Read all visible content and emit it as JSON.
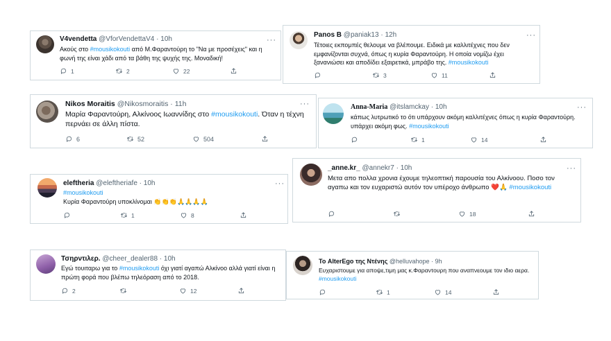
{
  "tweets": [
    {
      "name": "V4vendetta",
      "handle": "@VforVendettaV4",
      "time": "10h",
      "text_before": "Ακούς στο ",
      "hashtag": "#mousikokouti",
      "text_after": " από Μ.Φαραντούρη το \"Να με προσέχεις\" και η φωνή της είναι χάδι από τα βάθη της ψυχής της. Μοναδική!",
      "replies": "1",
      "retweets": "2",
      "likes": "22"
    },
    {
      "name": "Panos B",
      "handle": "@paniak13",
      "time": "12h",
      "text_before": "Τέτοιες εκπομπές θελουμε να βλέπουμε. Ειδικά με καλλιτέχνες που δεν εμφανίζονται συχνά, όπως η κυρία Φαραντούρη. Η οποία νομίζω έχει ξανανιώσει και αποδίδει εξαιρετικά, μπράβο της. ",
      "hashtag": "#mousikokouti",
      "text_after": "",
      "replies": "",
      "retweets": "3",
      "likes": "11"
    },
    {
      "name": "Nikos Moraitis",
      "handle": "@Nikosmoraitis",
      "time": "11h",
      "text_before": "Μαρία Φαραντούρη, Αλκίνοος Ιωαννίδης στο ",
      "hashtag": "#mousikokouti",
      "text_after": ". Όταν η τέχνη περνάει σε άλλη πίστα.",
      "replies": "6",
      "retweets": "52",
      "likes": "504"
    },
    {
      "name": "Anna-Maria",
      "handle": "@itslamckay",
      "time": "10h",
      "text_before": "κάπως λυτρωτικό το ότι υπάρχουν ακόμη καλλιτέχνες όπως η κυρία Φαραντούρη. υπάρχει ακόμη φως. ",
      "hashtag": "#mousikokouti",
      "text_after": "",
      "replies": "",
      "retweets": "1",
      "likes": "14"
    },
    {
      "name": "eleftheria",
      "handle": "@eleftheriafe",
      "time": "10h",
      "text_before": "",
      "hashtag": "#mousikokouti",
      "text_after": "Κυρία Φαραντούρη υποκλίνομαι 👏👏👏🙏🙏🙏🙏",
      "replies": "",
      "retweets": "1",
      "likes": "8"
    },
    {
      "name": "_anne.kr_",
      "handle": "@annekr7",
      "time": "10h",
      "text_before": "Μετα απο πολλα χρονια έχουμε τηλεοπτική παρουσία του Αλκίνοου. Ποσο τον αγαπω και τον ευχαριστώ αυτόν τον υπέροχο άνθρωπο ❤️🙏 ",
      "hashtag": "#mousikokouti",
      "text_after": "",
      "replies": "",
      "retweets": "",
      "likes": "18"
    },
    {
      "name": "Τσηρντιλερ.",
      "handle": "@cheer_dealer88",
      "time": "10h",
      "text_before": "Εγώ τουιταρω για το ",
      "hashtag": "#mousikokouti",
      "text_after": " όχι γιατί αγαπώ Αλκίνοο αλλά γιατί είναι η πρώτη φορά που βλέπω τηλεόραση από το 2018.",
      "replies": "2",
      "retweets": "",
      "likes": "12"
    },
    {
      "name": "Το AlterEgo της Ντένης",
      "handle": "@helluvahope",
      "time": "9h",
      "text_before": "Ευχαριστουμε για αποψε,τιμη μας κ.Φαραντουρη που αναπνεουμε τον ιδιο αερα. ",
      "hashtag": "#mousikokouti",
      "text_after": "",
      "replies": "",
      "retweets": "1",
      "likes": "14"
    }
  ],
  "icons": {
    "reply": "reply-icon",
    "retweet": "retweet-icon",
    "like": "heart-icon",
    "share": "share-icon",
    "more": "more-dots-icon"
  },
  "colors": {
    "hashtag": "#1d9bf0",
    "muted": "#536471",
    "border": "#cfd9de"
  }
}
